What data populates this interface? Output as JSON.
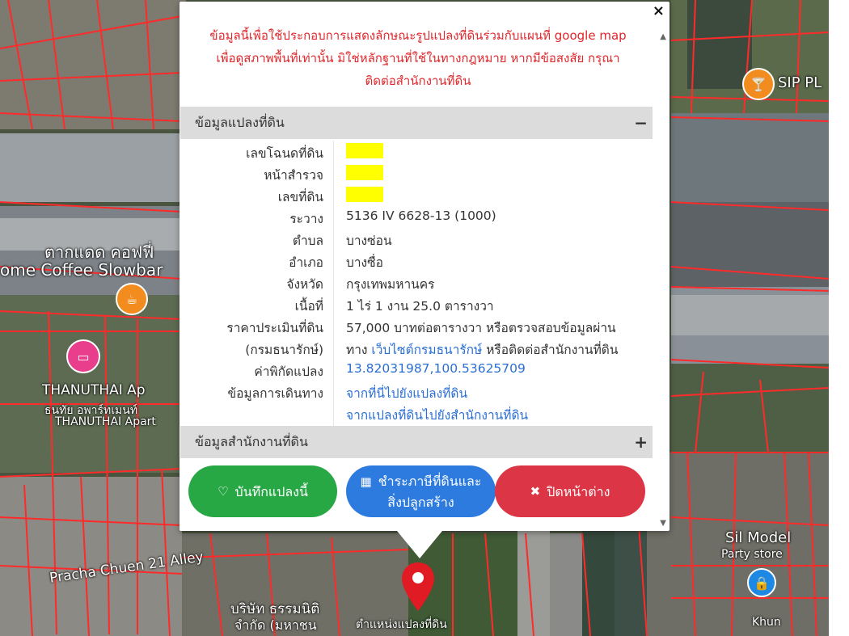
{
  "popup": {
    "close_symbol": "×",
    "warning_line1": "ข้อมูลนี้เพื่อใช้ประกอบการแสดงลักษณะรูปแปลงที่ดินร่วมกับแผนที่ google map",
    "warning_line2": "เพื่อดูสภาพพื้นที่เท่านั้น มิใช่หลักฐานที่ใช้ในทางกฎหมาย หากมีข้อสงสัย กรุณา",
    "warning_line3": "ติดต่อสำนักงานที่ดิน",
    "section_land": {
      "title": "ข้อมูลแปลงที่ดิน",
      "toggle": "−"
    },
    "section_office": {
      "title": "ข้อมูลสำนักงานที่ดิน",
      "toggle": "+"
    },
    "rows": {
      "deed_no": {
        "label": "เลขโฉนดที่ดิน"
      },
      "survey_page": {
        "label": "หน้าสำรวจ"
      },
      "land_no": {
        "label": "เลขที่ดิน"
      },
      "ravang": {
        "label": "ระวาง",
        "value": "5136 IV 6628-13 (1000)"
      },
      "tambon": {
        "label": "ตำบล",
        "value": "บางซ่อน"
      },
      "amphoe": {
        "label": "อำเภอ",
        "value": "บางซื่อ"
      },
      "province": {
        "label": "จังหวัด",
        "value": "กรุงเทพมหานคร"
      },
      "area": {
        "label": "เนื้อที่",
        "value": "1 ไร่ 1 งาน 25.0 ตารางวา"
      },
      "price": {
        "label": "ราคาประเมินที่ดิน",
        "value": "57,000 บาทต่อตารางวา หรือตรวจสอบข้อมูลผ่าน"
      },
      "price2": {
        "label": "(กรมธนารักษ์)",
        "prefix": "ทาง ",
        "link": "เว็บไซต์กรมธนารักษ์",
        "suffix": " หรือติดต่อสำนักงานที่ดิน"
      },
      "coords": {
        "label": "ค่าพิกัดแปลง",
        "value": "13.82031987,100.53625709"
      },
      "travel": {
        "label": "ข้อมูลการเดินทาง",
        "link1": "จากที่นี่ไปยังแปลงที่ดิน",
        "link2": "จากแปลงที่ดินไปยังสำนักงานที่ดิน"
      }
    },
    "buttons": {
      "save": "บันทึกแปลงนี้",
      "tax_line1": "ชำระภาษีที่ดินและ",
      "tax_line2": "สิ่งปลูกสร้าง",
      "close": "ปิดหน้าต่าง"
    }
  },
  "map": {
    "labels": {
      "cafe_th": "ตากแดด คอฟฟี่",
      "cafe_en": "ome Coffee Slowbar",
      "thanuthai": "THANUTHAI Ap",
      "thanuthai_th": "ธนทัย อพาร์ทเมนท์",
      "thanuthai2": "THANUTHAI Apart",
      "sip": "SIP PL",
      "sil_model": "Sil Model",
      "party_store": "Party store",
      "alley": "Pracha Chuen 21 Alley",
      "company": "บริษัท ธรรมนิติ",
      "company2": "จำกัด (มหาชน",
      "marker_label": "ตำแหน่งแปลงที่ดิน",
      "khun": "Khun"
    },
    "colors": {
      "parcel_line": "#ff2a2a",
      "marker": "#e01b24"
    }
  }
}
